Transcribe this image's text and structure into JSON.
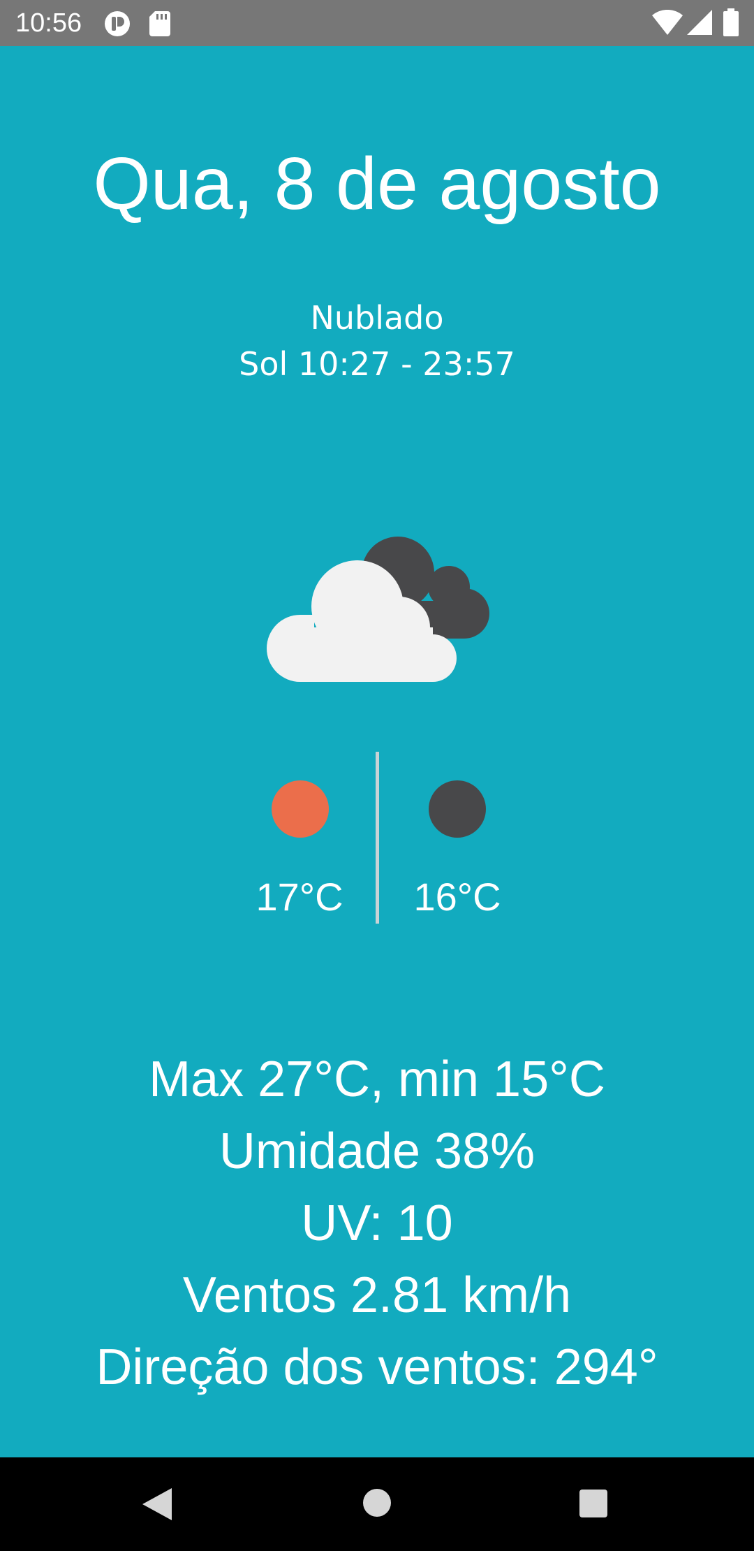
{
  "status_bar": {
    "time": "10:56",
    "icons": [
      "app-notification-icon",
      "sd-card-icon",
      "wifi-icon",
      "cell-signal-icon",
      "battery-icon"
    ]
  },
  "weather": {
    "date": "Qua, 8 de agosto",
    "condition": "Nublado",
    "sun": "Sol 10:27 - 23:57",
    "icon": "cloudy-icon",
    "day_temp": "17°C",
    "night_temp": "16°C",
    "day_color": "#eb6e4b",
    "night_color": "#48484a",
    "details": {
      "max_min": "Max 27°C, min 15°C",
      "humidity": "Umidade 38%",
      "uv": "UV: 10",
      "wind_speed": "Ventos 2.81 km/h",
      "wind_direction": "Direção dos ventos: 294°"
    }
  },
  "colors": {
    "background": "#12abbf",
    "status_bar": "#777777",
    "nav_bar": "#000000"
  },
  "nav_bar": {
    "buttons": [
      "back-icon",
      "home-icon",
      "recents-icon"
    ]
  }
}
